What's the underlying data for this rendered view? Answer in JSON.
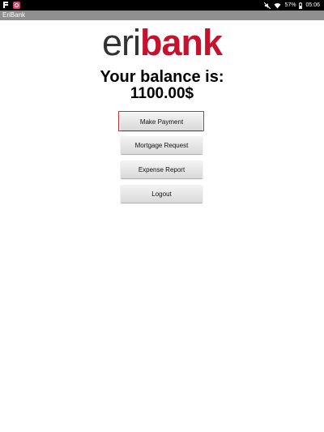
{
  "status_bar": {
    "battery": "57%",
    "time": "05:06",
    "left_icons": [
      "flipboard-icon",
      "instagram-icon"
    ],
    "right_icons": [
      "mute-icon",
      "wifi-icon",
      "battery-icon"
    ]
  },
  "app": {
    "title": "EriBank",
    "logo_part1": "eri",
    "logo_part2": "bank",
    "brand_color": "#c4122f"
  },
  "balance": {
    "label": "Your balance is:",
    "value": "1100.00$"
  },
  "buttons": {
    "make_payment": "Make Payment",
    "mortgage_request": "Mortgage Request",
    "expense_report": "Expense Report",
    "logout": "Logout"
  }
}
